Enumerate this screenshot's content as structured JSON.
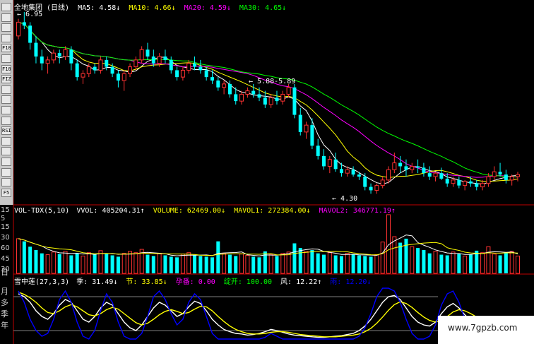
{
  "price_header": {
    "title": "全地集团 (日线)",
    "ma5_label": "MA5:",
    "ma5_value": "4.58↓",
    "ma10_label": "MA10:",
    "ma10_value": "4.66↓",
    "ma20_label": "MA20:",
    "ma20_value": "4.59↓",
    "ma30_label": "MA30:",
    "ma30_value": "4.65↓"
  },
  "volume_header": {
    "name": "VOL-TDX(5,10)",
    "vvol_label": "VVOL:",
    "vvol_value": "405204.31↑",
    "volume_label": "VOLUME:",
    "volume_value": "62469.00↓",
    "mavol1_label": "MAVOL1:",
    "mavol1_value": "272384.00↓",
    "mavol2_label": "MAVOL2:",
    "mavol2_value": "346771.19↑"
  },
  "indicator_header": {
    "name": "雪中莲(27,3,3)",
    "ji_label": "季:",
    "ji_value": "31.49↓",
    "jie_label": "节:",
    "jie_value": "33.85↓",
    "yun_label": "孕番:",
    "yun_value": "0.00",
    "zhan_label": "绽开:",
    "zhan_value": "100.00",
    "feng_label": "风:",
    "feng_value": "12.22↑",
    "yu_label": "雨:",
    "yu_value": "12.20↓"
  },
  "annotations": {
    "high": "6.95",
    "mid": "5.88-5.89",
    "low": "4.30"
  },
  "volume_axis": [
    "15",
    "5",
    "15",
    "30",
    "60",
    "45",
    "30",
    "15"
  ],
  "period_tabs": [
    "日",
    "月",
    "多",
    "季",
    "年"
  ],
  "toolbar_icons": [
    "cursor-icon",
    "line-icon",
    "grid-icon",
    "chart-icon",
    "f10-icon",
    "document-icon",
    "f10-icon",
    "fiz-icon",
    "calendar-icon",
    "list-icon",
    "search-icon",
    "trend-icon",
    "rsi-icon",
    "move-icon",
    "arrows-icon",
    "exit-icon",
    "tool-icon",
    "pen-icon",
    "f5-icon"
  ],
  "toolbar_labels": [
    "",
    "",
    "",
    "",
    "F10",
    "",
    "F10",
    "FIZ",
    "",
    "",
    "",
    "",
    "RSI",
    "",
    "",
    "",
    "",
    "",
    "F5"
  ],
  "watermark": "www.7gpzb.com",
  "colors": {
    "up": "#ff3232",
    "down": "#00ffff",
    "ma5": "#ffffff",
    "ma10": "#ffff00",
    "ma20": "#ff00ff",
    "ma30": "#00ff00",
    "axis": "#c00000",
    "yu": "#0000ff"
  },
  "chart_data": [
    {
      "type": "candlestick",
      "title": "全地集团 (日线)",
      "series_names": [
        "MA5",
        "MA10",
        "MA20",
        "MA30"
      ],
      "ohlc": [
        [
          6.6,
          6.85,
          6.55,
          6.8
        ],
        [
          6.8,
          6.95,
          6.7,
          6.75
        ],
        [
          6.75,
          6.8,
          6.4,
          6.5
        ],
        [
          6.5,
          6.6,
          6.2,
          6.3
        ],
        [
          6.3,
          6.4,
          6.1,
          6.2
        ],
        [
          6.2,
          6.3,
          6.05,
          6.25
        ],
        [
          6.25,
          6.4,
          6.2,
          6.35
        ],
        [
          6.35,
          6.4,
          6.2,
          6.3
        ],
        [
          6.3,
          6.45,
          6.25,
          6.4
        ],
        [
          6.4,
          6.45,
          6.1,
          6.2
        ],
        [
          6.2,
          6.25,
          5.95,
          6.0
        ],
        [
          6.0,
          6.1,
          5.9,
          6.05
        ],
        [
          6.05,
          6.2,
          6.0,
          6.15
        ],
        [
          6.15,
          6.2,
          6.05,
          6.1
        ],
        [
          6.1,
          6.3,
          6.05,
          6.25
        ],
        [
          6.25,
          6.3,
          6.1,
          6.15
        ],
        [
          6.15,
          6.2,
          6.0,
          6.05
        ],
        [
          6.05,
          6.1,
          5.85,
          5.95
        ],
        [
          5.95,
          6.1,
          5.8,
          6.05
        ],
        [
          6.05,
          6.2,
          6.0,
          6.15
        ],
        [
          6.15,
          6.3,
          6.1,
          6.25
        ],
        [
          6.25,
          6.45,
          6.2,
          6.4
        ],
        [
          6.4,
          6.5,
          6.25,
          6.3
        ],
        [
          6.3,
          6.4,
          6.15,
          6.2
        ],
        [
          6.2,
          6.35,
          6.15,
          6.3
        ],
        [
          6.3,
          6.4,
          6.2,
          6.25
        ],
        [
          6.25,
          6.3,
          6.05,
          6.1
        ],
        [
          6.1,
          6.15,
          5.95,
          6.0
        ],
        [
          6.0,
          6.15,
          5.95,
          6.1
        ],
        [
          6.1,
          6.25,
          6.05,
          6.2
        ],
        [
          6.2,
          6.3,
          6.1,
          6.15
        ],
        [
          6.15,
          6.25,
          6.05,
          6.1
        ],
        [
          6.1,
          6.15,
          5.95,
          6.0
        ],
        [
          6.0,
          6.1,
          5.9,
          5.95
        ],
        [
          5.95,
          6.0,
          5.8,
          5.85
        ],
        [
          5.85,
          5.95,
          5.75,
          5.9
        ],
        [
          5.9,
          5.95,
          5.7,
          5.75
        ],
        [
          5.75,
          5.85,
          5.6,
          5.65
        ],
        [
          5.65,
          5.8,
          5.6,
          5.75
        ],
        [
          5.75,
          5.85,
          5.7,
          5.8
        ],
        [
          5.8,
          5.9,
          5.7,
          5.75
        ],
        [
          5.75,
          5.85,
          5.65,
          5.7
        ],
        [
          5.7,
          5.8,
          5.55,
          5.6
        ],
        [
          5.6,
          5.75,
          5.55,
          5.7
        ],
        [
          5.7,
          5.8,
          5.6,
          5.65
        ],
        [
          5.65,
          5.8,
          5.6,
          5.75
        ],
        [
          5.75,
          5.9,
          5.7,
          5.85
        ],
        [
          5.85,
          5.9,
          5.4,
          5.45
        ],
        [
          5.45,
          5.55,
          5.15,
          5.2
        ],
        [
          5.2,
          5.35,
          5.1,
          5.3
        ],
        [
          5.3,
          5.4,
          4.95,
          5.0
        ],
        [
          5.0,
          5.1,
          4.8,
          4.85
        ],
        [
          4.85,
          4.95,
          4.65,
          4.7
        ],
        [
          4.7,
          4.85,
          4.6,
          4.8
        ],
        [
          4.8,
          4.9,
          4.62,
          4.66
        ],
        [
          4.66,
          4.75,
          4.55,
          4.6
        ],
        [
          4.6,
          4.7,
          4.55,
          4.65
        ],
        [
          4.65,
          4.7,
          4.55,
          4.58
        ],
        [
          4.58,
          4.62,
          4.5,
          4.55
        ],
        [
          4.55,
          4.6,
          4.35,
          4.4
        ],
        [
          4.4,
          4.45,
          4.3,
          4.35
        ],
        [
          4.35,
          4.45,
          4.3,
          4.42
        ],
        [
          4.42,
          4.55,
          4.38,
          4.5
        ],
        [
          4.5,
          4.7,
          4.45,
          4.65
        ],
        [
          4.65,
          4.9,
          4.6,
          4.75
        ],
        [
          4.75,
          4.85,
          4.6,
          4.7
        ],
        [
          4.7,
          4.8,
          4.55,
          4.65
        ],
        [
          4.65,
          4.75,
          4.6,
          4.7
        ],
        [
          4.7,
          4.8,
          4.6,
          4.68
        ],
        [
          4.68,
          4.75,
          4.55,
          4.6
        ],
        [
          4.6,
          4.7,
          4.5,
          4.55
        ],
        [
          4.55,
          4.62,
          4.48,
          4.6
        ],
        [
          4.6,
          4.68,
          4.5,
          4.52
        ],
        [
          4.52,
          4.6,
          4.4,
          4.45
        ],
        [
          4.45,
          4.55,
          4.4,
          4.5
        ],
        [
          4.5,
          4.55,
          4.38,
          4.42
        ],
        [
          4.42,
          4.5,
          4.35,
          4.48
        ],
        [
          4.48,
          4.55,
          4.4,
          4.45
        ],
        [
          4.45,
          4.5,
          4.35,
          4.4
        ],
        [
          4.4,
          4.5,
          4.35,
          4.45
        ],
        [
          4.45,
          4.6,
          4.4,
          4.55
        ],
        [
          4.55,
          4.7,
          4.5,
          4.62
        ],
        [
          4.62,
          4.75,
          4.55,
          4.58
        ],
        [
          4.58,
          4.65,
          4.45,
          4.5
        ],
        [
          4.5,
          4.58,
          4.42,
          4.55
        ],
        [
          4.55,
          4.62,
          4.48,
          4.58
        ]
      ]
    },
    {
      "type": "bar",
      "title": "VOL-TDX(5,10)",
      "values": [
        52,
        48,
        40,
        35,
        30,
        28,
        32,
        29,
        33,
        27,
        30,
        26,
        31,
        28,
        34,
        29,
        27,
        25,
        30,
        33,
        31,
        36,
        28,
        26,
        30,
        27,
        25,
        24,
        29,
        31,
        27,
        26,
        25,
        24,
        48,
        30,
        28,
        26,
        29,
        27,
        25,
        24,
        33,
        28,
        26,
        30,
        32,
        45,
        38,
        33,
        35,
        30,
        28,
        31,
        27,
        26,
        30,
        29,
        27,
        26,
        25,
        28,
        47,
        88,
        55,
        46,
        52,
        40,
        38,
        35,
        30,
        33,
        28,
        27,
        32,
        29,
        26,
        28,
        34,
        31,
        40,
        29,
        27,
        31,
        33,
        26
      ]
    },
    {
      "type": "line",
      "title": "雪中莲(27,3,3)",
      "series": [
        {
          "name": "季",
          "values": [
            85,
            80,
            70,
            55,
            45,
            40,
            50,
            65,
            75,
            70,
            55,
            40,
            35,
            45,
            60,
            70,
            65,
            50,
            35,
            25,
            20,
            30,
            45,
            60,
            70,
            65,
            55,
            45,
            50,
            62,
            72,
            68,
            55,
            40,
            30,
            22,
            18,
            15,
            14,
            12,
            13,
            15,
            18,
            22,
            20,
            17,
            14,
            12,
            11,
            10,
            9,
            8,
            8,
            9,
            10,
            11,
            13,
            15,
            20,
            28,
            40,
            55,
            70,
            80,
            82,
            75,
            60,
            45,
            35,
            30,
            28,
            35,
            50,
            62,
            68,
            60,
            48,
            38,
            32,
            30,
            35,
            45,
            40,
            34,
            32,
            31
          ]
        },
        {
          "name": "节",
          "values": [
            88,
            84,
            78,
            70,
            60,
            52,
            50,
            55,
            62,
            66,
            62,
            55,
            48,
            46,
            50,
            57,
            61,
            58,
            50,
            42,
            34,
            30,
            33,
            40,
            48,
            54,
            57,
            54,
            50,
            52,
            58,
            63,
            62,
            55,
            45,
            36,
            28,
            22,
            18,
            15,
            14,
            14,
            15,
            17,
            18,
            18,
            17,
            15,
            13,
            12,
            11,
            10,
            9,
            9,
            9,
            10,
            11,
            12,
            14,
            18,
            24,
            33,
            44,
            56,
            66,
            71,
            68,
            61,
            52,
            44,
            38,
            35,
            38,
            45,
            53,
            57,
            55,
            50,
            44,
            40,
            38,
            40,
            41,
            38,
            35,
            33.85
          ]
        },
        {
          "name": "雨",
          "values": [
            90,
            70,
            40,
            20,
            10,
            15,
            40,
            75,
            90,
            70,
            35,
            10,
            5,
            20,
            55,
            85,
            70,
            35,
            10,
            5,
            5,
            15,
            45,
            80,
            90,
            75,
            50,
            30,
            40,
            70,
            85,
            75,
            45,
            15,
            5,
            5,
            5,
            5,
            5,
            5,
            5,
            5,
            8,
            15,
            10,
            5,
            5,
            5,
            5,
            5,
            5,
            5,
            5,
            5,
            5,
            5,
            5,
            5,
            10,
            25,
            50,
            80,
            95,
            95,
            90,
            70,
            40,
            15,
            5,
            5,
            10,
            30,
            65,
            85,
            90,
            70,
            40,
            15,
            5,
            5,
            20,
            45,
            40,
            20,
            15,
            12.2
          ]
        }
      ]
    }
  ]
}
